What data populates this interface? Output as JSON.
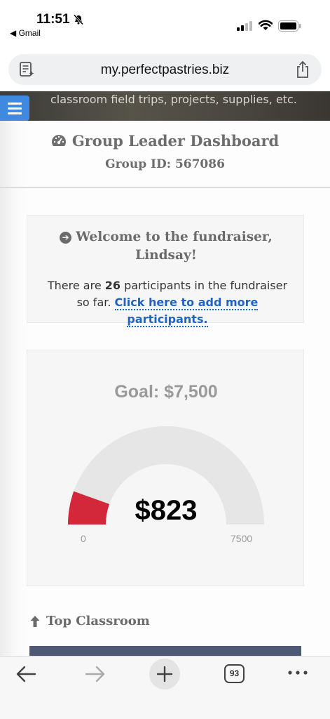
{
  "status": {
    "time": "11:51",
    "back_app": "◀ Gmail"
  },
  "browser": {
    "url": "my.perfectpastries.biz",
    "tab_count": "93"
  },
  "hero": {
    "text": "classroom field trips, projects, supplies, etc."
  },
  "dashboard": {
    "title": "Group Leader Dashboard",
    "group_id": "Group ID: 567086"
  },
  "welcome": {
    "title_line1": "Welcome to the fundraiser,",
    "title_line2": "Lindsay!",
    "text_before": "There are ",
    "participant_count": "26",
    "text_after": " participants in the fundraiser so far. ",
    "link_label": "Click here to add more participants."
  },
  "goal": {
    "title": "Goal: $7,500",
    "raised_label": "$823",
    "raised": 823,
    "min_label": "0",
    "max_label": "7500",
    "min": 0,
    "max": 7500,
    "fill_color": "#d3283a",
    "track_color": "#e6e6e6"
  },
  "top_classroom": {
    "heading": "Top Classroom"
  }
}
